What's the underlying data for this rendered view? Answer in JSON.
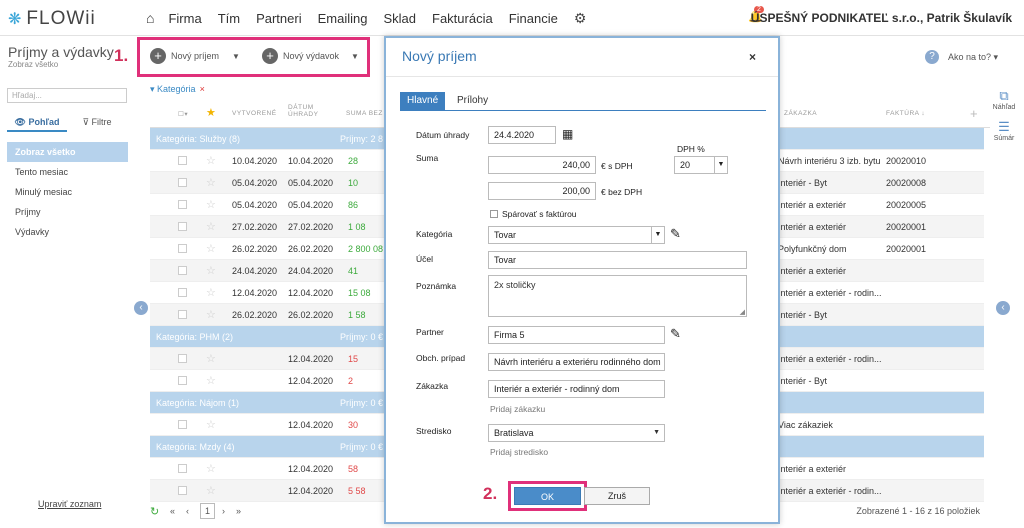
{
  "app": {
    "logo": "FLOWii",
    "company": "ÚSPEŠNÝ PODNIKATEĽ s.r.o., Patrik Škulavík",
    "notifications": "2"
  },
  "nav": [
    "Firma",
    "Tím",
    "Partneri",
    "Emailing",
    "Sklad",
    "Fakturácia",
    "Financie"
  ],
  "left": {
    "title": "Príjmy a výdavky",
    "subtitle": "Zobraz všetko",
    "step": "1.",
    "search_placeholder": "Hľadaj...",
    "tabs": [
      "Pohľad",
      "Filtre"
    ],
    "menu": [
      "Zobraz všetko",
      "Tento mesiac",
      "Minulý mesiac",
      "Príjmy",
      "Výdavky"
    ],
    "footer": "Upraviť zoznam"
  },
  "toolbar": {
    "new_income": "Nový príjem",
    "new_expense": "Nový výdavok",
    "help": "Ako na to?"
  },
  "filter_chip": "Kategória",
  "columns": {
    "created": "VYTVORENÉ",
    "paid": "DÁTUM ÚHRADY",
    "sum": "SUMA BEZ",
    "order": "ZÁKAZKA",
    "invoice": "FAKTÚRA"
  },
  "rows": [
    {
      "type": "cat",
      "label": "Kategória: Služby (8)",
      "extra": "Príjmy: 2 8"
    },
    {
      "c": "10.04.2020",
      "p": "10.04.2020",
      "s": "28",
      "sc": "green",
      "z": "Návrh interiéru 3 izb. bytu",
      "f": "20020010"
    },
    {
      "c": "05.04.2020",
      "p": "05.04.2020",
      "s": "10",
      "sc": "green",
      "z": "Interiér - Byt",
      "f": "20020008"
    },
    {
      "c": "05.04.2020",
      "p": "05.04.2020",
      "s": "86",
      "sc": "green",
      "z": "Interiér a exteriér",
      "f": "20020005"
    },
    {
      "c": "27.02.2020",
      "p": "27.02.2020",
      "s": "1 08",
      "sc": "green",
      "z": "Interiér a exteriér",
      "f": "20020001"
    },
    {
      "c": "26.02.2020",
      "p": "26.02.2020",
      "s": "2 800 08",
      "sc": "green",
      "z": "Polyfunkčný dom",
      "f": "20020001"
    },
    {
      "c": "24.04.2020",
      "p": "24.04.2020",
      "s": "41",
      "sc": "green",
      "z": "Interiér a exteriér",
      "f": ""
    },
    {
      "c": "12.04.2020",
      "p": "12.04.2020",
      "s": "15 08",
      "sc": "green",
      "z": "Interiér a exteriér - rodin...",
      "f": ""
    },
    {
      "c": "26.02.2020",
      "p": "26.02.2020",
      "s": "1 58",
      "sc": "green",
      "z": "Interiér - Byt",
      "f": ""
    },
    {
      "type": "cat",
      "label": "Kategória: PHM (2)",
      "extra": "Príjmy: 0 €"
    },
    {
      "c": "",
      "p": "12.04.2020",
      "s": "15",
      "sc": "red",
      "z": "Interiér a exteriér - rodin...",
      "f": ""
    },
    {
      "c": "",
      "p": "12.04.2020",
      "s": "2",
      "sc": "red",
      "z": "Interiér - Byt",
      "f": ""
    },
    {
      "type": "cat",
      "label": "Kategória: Nájom (1)",
      "extra": "Príjmy: 0 €"
    },
    {
      "c": "",
      "p": "12.04.2020",
      "s": "30",
      "sc": "red",
      "z": "Viac zákaziek",
      "f": ""
    },
    {
      "type": "cat",
      "label": "Kategória: Mzdy (4)",
      "extra": "Príjmy: 0 €"
    },
    {
      "c": "",
      "p": "12.04.2020",
      "s": "58",
      "sc": "red",
      "z": "Interiér a exteriér",
      "f": ""
    },
    {
      "c": "",
      "p": "12.04.2020",
      "s": "5 58",
      "sc": "red",
      "z": "Interiér a exteriér - rodin...",
      "f": ""
    }
  ],
  "pager": {
    "page": "1",
    "summary": "Zobrazené 1 - 16 z 16 položiek"
  },
  "right_tools": {
    "detail": "Náhľad",
    "summary": "Súmár"
  },
  "modal": {
    "title": "Nový príjem",
    "tabs": [
      "Hlavné",
      "Prílohy"
    ],
    "date_label": "Dátum úhrady",
    "date_value": "24.4.2020",
    "sum_label": "Suma",
    "vat_label": "DPH %",
    "amount_with_vat": "240,00",
    "with_vat_unit": "€ s DPH",
    "vat_value": "20",
    "amount_without_vat": "200,00",
    "without_vat_unit": "€ bez DPH",
    "pair_invoice": "Spárovať s faktúrou",
    "category_label": "Kategória",
    "category_value": "Tovar",
    "purpose_label": "Účel",
    "purpose_value": "Tovar",
    "note_label": "Poznámka",
    "note_value": "2x stoličky",
    "partner_label": "Partner",
    "partner_value": "Firma 5",
    "case_label": "Obch. prípad",
    "case_value": "Návrh interiéru a exteriéru rodinného dom",
    "order_label": "Zákazka",
    "order_value": "Interiér a exteriér - rodinný dom",
    "add_order": "Pridaj zákazku",
    "center_label": "Stredisko",
    "center_value": "Bratislava",
    "add_center": "Pridaj stredisko",
    "ok": "OK",
    "cancel": "Zruš",
    "step": "2."
  }
}
